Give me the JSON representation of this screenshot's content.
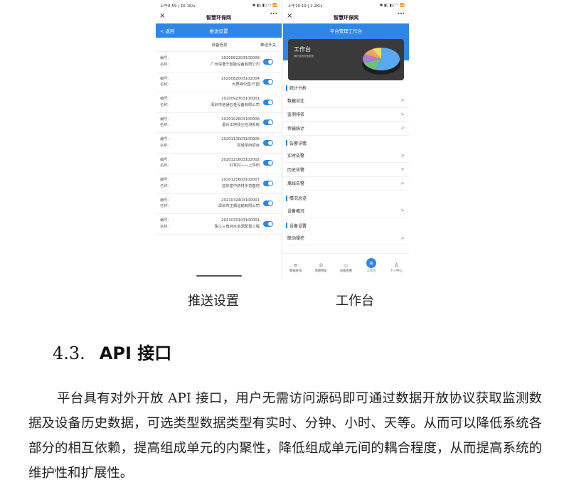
{
  "left_phone": {
    "status_time": "上午8:59 | 16.1K/s",
    "status_icons": "✱ ▮▯ ▮▯ ◠ 📶",
    "app_title": "智慧环保网",
    "close": "×",
    "more": "···",
    "back": "< 返回",
    "nav_title": "推送设置",
    "col_device": "设备信息",
    "col_switch": "推送开关",
    "label_id": "编号:",
    "label_name": "名称:",
    "rows": [
      {
        "id": "2020062203100008",
        "name": "广州深晋宁智能设备有限公司"
      },
      {
        "id": "2020082003102004",
        "name": "大屏峰公园-竹园"
      },
      {
        "id": "2020092703100001",
        "name": "深圳市信通五金设备有限公司"
      },
      {
        "id": "2020102603100006",
        "name": "温州工地扬尘检测系统"
      },
      {
        "id": "2020113003100006",
        "name": "百城学府项目"
      },
      {
        "id": "2020121603102002",
        "name": "红军村——上坪田"
      },
      {
        "id": "2020121603102007",
        "name": "益年堂中药材示范基地"
      },
      {
        "id": "2021032403100001",
        "name": "深圳市正顺运输有限公司"
      },
      {
        "id": "2021033103100001",
        "name": "珠江三角洲水资源配置工程"
      }
    ]
  },
  "right_phone": {
    "status_time": "上午10:19 | 2.2K/s",
    "status_icons": "✱ ▮▯ ▮▯ ◠ 📶",
    "app_title": "智慧环保网",
    "close": "×",
    "more": "···",
    "nav_title": "平台管理工作台",
    "banner_title": "工作台",
    "banner_sub": "随时查看设备数据",
    "pie_colors": [
      "#5aa9f0",
      "#6cc27a",
      "#b27bd6",
      "#f0a35a",
      "#e8e06a"
    ],
    "sections": [
      {
        "title": "统计分析",
        "items": [
          "数据对比",
          "监测排名",
          "传输统计"
        ]
      },
      {
        "title": "告警详情",
        "items": [
          "实时告警",
          "历史告警",
          "离线告警"
        ]
      },
      {
        "title": "情况总览",
        "items": [
          "设备概况"
        ]
      },
      {
        "title": "设备设置",
        "items": [
          "联动操控"
        ]
      }
    ],
    "chevron": ">",
    "tabs": [
      {
        "icon": "≡",
        "label": "数据查询"
      },
      {
        "icon": "◎",
        "label": "地图预览"
      },
      {
        "icon": "▭",
        "label": "设备查看"
      },
      {
        "icon": "⊞",
        "label": "工作台"
      },
      {
        "icon": "♙",
        "label": "个人中心"
      }
    ]
  },
  "caption_left": "推送设置",
  "caption_right": "工作台",
  "heading_number": "4.3.",
  "heading_text": "API 接口",
  "paragraph": "平台具有对外开放 API 接口，用户无需访问源码即可通过数据开放协议获取监测数据及设备历史数据，可选类型数据类型有实时、分钟、小时、天等。从而可以降低系统各部分的相互依赖，提高组成单元的内聚性，降低组成单元间的耦合程度，从而提高系统的维护性和扩展性。"
}
